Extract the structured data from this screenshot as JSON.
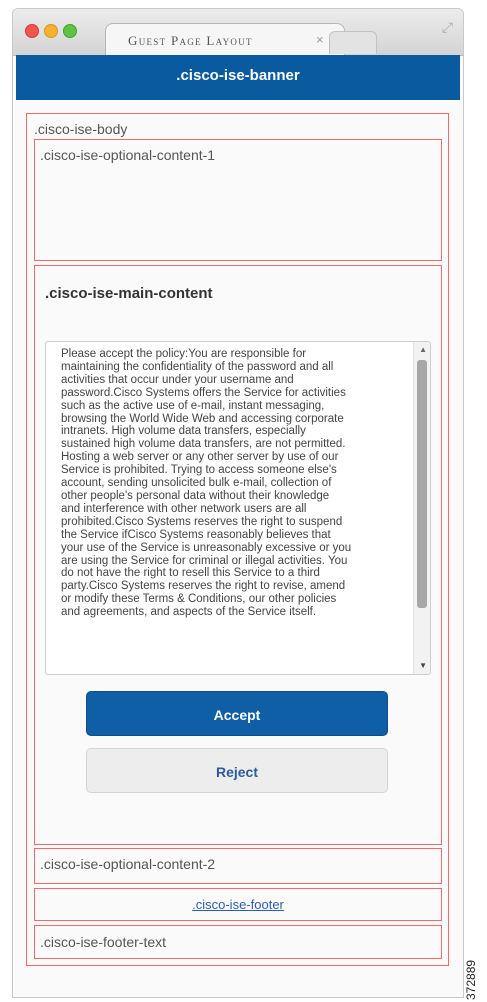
{
  "tab": {
    "title": "Guest Page Layout",
    "close_glyph": "×"
  },
  "banner": {
    "label": ".cisco-ise-banner"
  },
  "body": {
    "label": ".cisco-ise-body"
  },
  "optional_content_1": {
    "label": ".cisco-ise-optional-content-1"
  },
  "main_content": {
    "label": ".cisco-ise-main-content",
    "policy_lines": [
      "Please accept the policy:You are responsible for",
      "maintaining the confidentiality of the password and all",
      "activities that occur under your username and",
      "password.Cisco Systems offers the Service for activities",
      "such as the active use of e-mail, instant messaging,",
      "browsing the World Wide Web and accessing corporate",
      "intranets. High volume data transfers, especially",
      "sustained high volume data transfers, are not permitted.",
      "Hosting a web server or any other server by use of our",
      "Service is prohibited. Trying to access someone else's",
      "account, sending unsolicited bulk e-mail, collection of",
      "other people's personal data without their knowledge",
      "and interference with other network users are all",
      "prohibited.Cisco Systems reserves the right to suspend",
      "the Service ifCisco Systems reasonably believes that",
      "your use of the Service is unreasonably excessive or you",
      "are using the Service for criminal or illegal activities. You",
      "do not have the right to resell this Service to a third",
      "party.Cisco Systems reserves the right to revise, amend",
      "or modify these Terms & Conditions, our other policies",
      "and agreements, and aspects of the Service itself."
    ],
    "accept_label": "Accept",
    "reject_label": "Reject"
  },
  "optional_content_2": {
    "label": ".cisco-ise-optional-content-2"
  },
  "footer": {
    "link_label": ".cisco-ise-footer"
  },
  "footer_text": {
    "label": ".cisco-ise-footer-text"
  },
  "figure_id": "372889",
  "colors": {
    "banner": "#0a5aa0",
    "accept_button": "#0f5fa6",
    "outline": "#f06a6a"
  },
  "icons": [
    "close-window",
    "minimize-window",
    "zoom-window",
    "tab-close",
    "expand",
    "scroll-up",
    "scroll-down"
  ]
}
